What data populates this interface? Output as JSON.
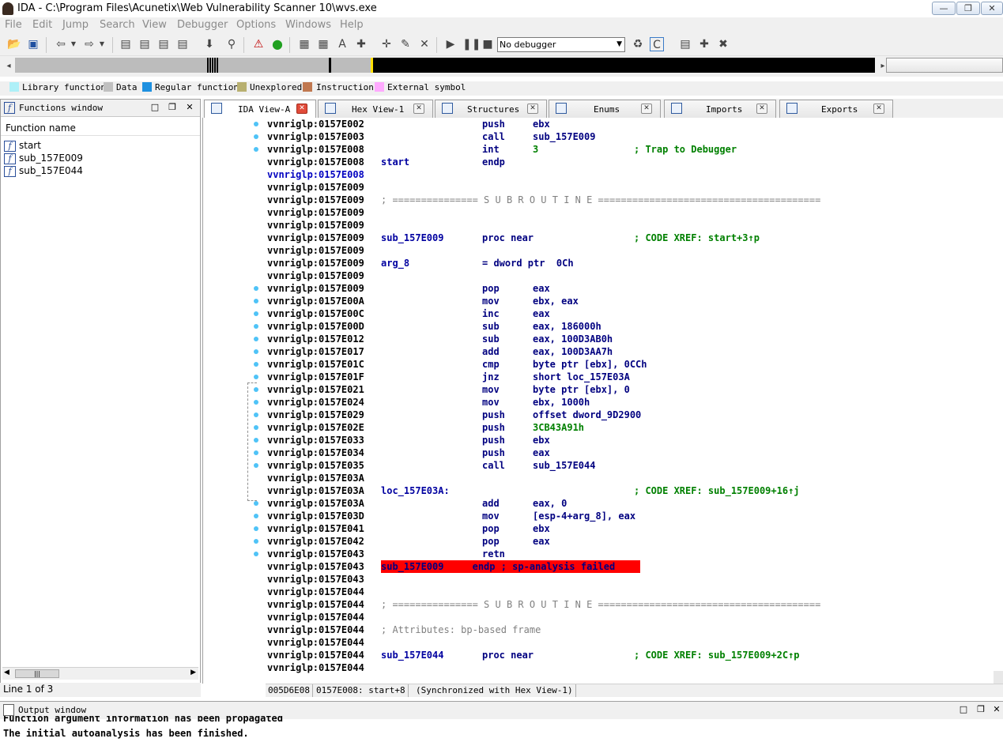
{
  "window": {
    "title": "IDA - C:\\Program Files\\Acunetix\\Web Vulnerability Scanner 10\\wvs.exe"
  },
  "menu": [
    "File",
    "Edit",
    "Jump",
    "Search",
    "View",
    "Debugger",
    "Options",
    "Windows",
    "Help"
  ],
  "toolbar": {
    "debugger_select": "No debugger"
  },
  "legend": [
    {
      "label": "Library function",
      "color": "#aef0f8"
    },
    {
      "label": "Data",
      "color": "#c0c0c0"
    },
    {
      "label": "Regular function",
      "color": "#1e90e0"
    },
    {
      "label": "Unexplored",
      "color": "#b8b070"
    },
    {
      "label": "Instruction",
      "color": "#c07850"
    },
    {
      "label": "External symbol",
      "color": "#ffaaff"
    }
  ],
  "functions": {
    "title": "Functions window",
    "column": "Function name",
    "items": [
      "start",
      "sub_157E009",
      "sub_157E044"
    ],
    "status": "Line 1 of 3"
  },
  "tabs": [
    "IDA View-A",
    "Hex View-1",
    "Structures",
    "Enums",
    "Imports",
    "Exports"
  ],
  "disasm": {
    "lines": [
      {
        "a": "vvnriglp:0157E002",
        "m": "push",
        "o": "ebx"
      },
      {
        "a": "vvnriglp:0157E003",
        "m": "call",
        "o": "sub_157E009"
      },
      {
        "a": "vvnriglp:0157E008",
        "m": "int",
        "o": "3",
        "c": "; Trap to Debugger"
      },
      {
        "a": "vvnriglp:0157E008",
        "l": "start",
        "m": "endp"
      },
      {
        "a": "vvnriglp:0157E008",
        "cur": true
      },
      {
        "a": "vvnriglp:0157E009"
      },
      {
        "a": "vvnriglp:0157E009",
        "g": "; =============== S U B R O U T I N E ======================================="
      },
      {
        "a": "vvnriglp:0157E009"
      },
      {
        "a": "vvnriglp:0157E009"
      },
      {
        "a": "vvnriglp:0157E009",
        "l": "sub_157E009",
        "m": "proc near",
        "c": "; CODE XREF: start+3↑p"
      },
      {
        "a": "vvnriglp:0157E009"
      },
      {
        "a": "vvnriglp:0157E009",
        "l": "arg_8",
        "m": "= dword ptr  0Ch"
      },
      {
        "a": "vvnriglp:0157E009"
      },
      {
        "a": "vvnriglp:0157E009",
        "m": "pop",
        "o": "eax"
      },
      {
        "a": "vvnriglp:0157E00A",
        "m": "mov",
        "o": "ebx, eax"
      },
      {
        "a": "vvnriglp:0157E00C",
        "m": "inc",
        "o": "eax"
      },
      {
        "a": "vvnriglp:0157E00D",
        "m": "sub",
        "o": "eax, 186000h"
      },
      {
        "a": "vvnriglp:0157E012",
        "m": "sub",
        "o": "eax, 100D3AB0h"
      },
      {
        "a": "vvnriglp:0157E017",
        "m": "add",
        "o": "eax, 100D3AA7h"
      },
      {
        "a": "vvnriglp:0157E01C",
        "m": "cmp",
        "o": "byte ptr [ebx], 0CCh"
      },
      {
        "a": "vvnriglp:0157E01F",
        "m": "jnz",
        "o": "short loc_157E03A"
      },
      {
        "a": "vvnriglp:0157E021",
        "m": "mov",
        "o": "byte ptr [ebx], 0"
      },
      {
        "a": "vvnriglp:0157E024",
        "m": "mov",
        "o": "ebx, 1000h"
      },
      {
        "a": "vvnriglp:0157E029",
        "m": "push",
        "o": "offset dword_9D2900"
      },
      {
        "a": "vvnriglp:0157E02E",
        "m": "push",
        "o": "3CB43A91h"
      },
      {
        "a": "vvnriglp:0157E033",
        "m": "push",
        "o": "ebx"
      },
      {
        "a": "vvnriglp:0157E034",
        "m": "push",
        "o": "eax"
      },
      {
        "a": "vvnriglp:0157E035",
        "m": "call",
        "o": "sub_157E044"
      },
      {
        "a": "vvnriglp:0157E03A"
      },
      {
        "a": "vvnriglp:0157E03A",
        "l": "loc_157E03A:",
        "c": "; CODE XREF: sub_157E009+16↑j"
      },
      {
        "a": "vvnriglp:0157E03A",
        "m": "add",
        "o": "eax, 0"
      },
      {
        "a": "vvnriglp:0157E03D",
        "m": "mov",
        "o": "[esp-4+arg_8], eax"
      },
      {
        "a": "vvnriglp:0157E041",
        "m": "pop",
        "o": "ebx"
      },
      {
        "a": "vvnriglp:0157E042",
        "m": "pop",
        "o": "eax"
      },
      {
        "a": "vvnriglp:0157E043",
        "m": "retn"
      },
      {
        "a": "vvnriglp:0157E043",
        "e": "sub_157E009     endp ; sp-analysis failed"
      },
      {
        "a": "vvnriglp:0157E043"
      },
      {
        "a": "vvnriglp:0157E044"
      },
      {
        "a": "vvnriglp:0157E044",
        "g": "; =============== S U B R O U T I N E ======================================="
      },
      {
        "a": "vvnriglp:0157E044"
      },
      {
        "a": "vvnriglp:0157E044",
        "g": "; Attributes: bp-based frame"
      },
      {
        "a": "vvnriglp:0157E044"
      },
      {
        "a": "vvnriglp:0157E044",
        "l": "sub_157E044",
        "m": "proc near",
        "c": "; CODE XREF: sub_157E009+2C↑p"
      },
      {
        "a": "vvnriglp:0157E044"
      }
    ],
    "status": [
      "005D6E08",
      "0157E008: start+8",
      "(Synchronized with Hex View-1)"
    ]
  },
  "output": {
    "title": "Output window",
    "lines": [
      "Function argument information has been propagated",
      "The initial autoanalysis has been finished."
    ]
  }
}
